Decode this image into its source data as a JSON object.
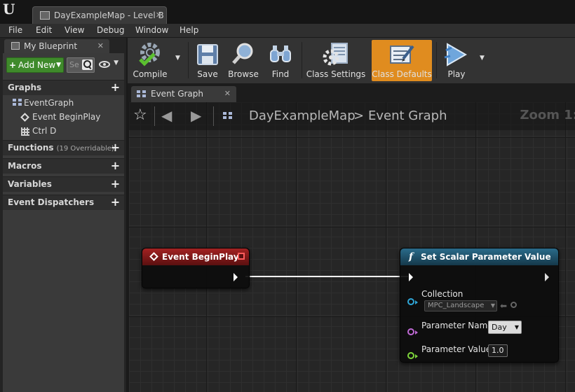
{
  "window": {
    "doc_tab": "DayExampleMap - Level B",
    "logo": "U"
  },
  "menu": [
    "File",
    "Edit",
    "View",
    "Debug",
    "Window",
    "Help"
  ],
  "left_panel": {
    "tab_title": "My Blueprint",
    "add_new_label": "Add New",
    "search_placeholder": "Se",
    "sections": {
      "graphs": "Graphs",
      "functions": "Functions",
      "functions_note": "(19 Overridable)",
      "macros": "Macros",
      "variables": "Variables",
      "event_dispatchers": "Event Dispatchers"
    },
    "tree": {
      "event_graph": "EventGraph",
      "begin_play": "Event BeginPlay",
      "ctrl_d": "Ctrl D"
    }
  },
  "toolbar": {
    "compile": "Compile",
    "save": "Save",
    "browse": "Browse",
    "find": "Find",
    "class_settings": "Class Settings",
    "class_defaults": "Class Defaults",
    "play": "Play",
    "accent": "#e08c1f"
  },
  "graph_tab": "Event Graph",
  "breadcrumb": {
    "root": "DayExampleMap",
    "sep": ">",
    "current": "Event Graph"
  },
  "zoom_label": "Zoom 1:",
  "nodes": {
    "begin_play": {
      "title": "Event BeginPlay",
      "header_color": "#8a1a1a"
    },
    "set_scalar": {
      "title": "Set Scalar Parameter Value",
      "func_glyph": "f",
      "header_color": "#1f4f66",
      "collection_label": "Collection",
      "collection_value": "MPC_Landscape",
      "param_name_label": "Parameter Name",
      "param_name_value": "Day",
      "param_value_label": "Parameter Value",
      "param_value_value": "1.0"
    }
  }
}
